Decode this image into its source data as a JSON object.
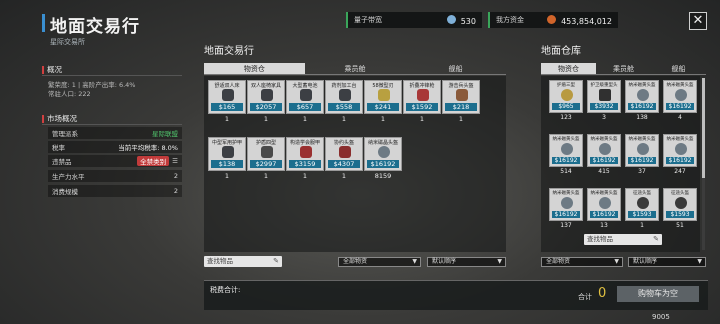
{
  "header": {
    "title": "地面交易行",
    "subtitle": "星际交易所",
    "bandwidth_label": "量子带宽",
    "bandwidth_value": "530",
    "funds_label": "我方资金",
    "funds_value": "453,854,012"
  },
  "overview": {
    "heading": "概况",
    "line1": "繁荣度: 1 | 高阶产出率: 6.4%",
    "line2": "常驻人口: 222"
  },
  "market": {
    "heading": "市场概况",
    "rows": [
      {
        "label": "管理派系",
        "value": "星际联盟"
      },
      {
        "label": "税率",
        "value": "当前平均税率: 8.0%"
      },
      {
        "label": "违禁品",
        "value": "全禁类别"
      },
      {
        "label": "生产力水平",
        "value": "2"
      },
      {
        "label": "消费规模",
        "value": "2"
      }
    ]
  },
  "trade": {
    "title": "地面交易行",
    "tabs": [
      "物资仓",
      "乘员舱",
      "舰船"
    ],
    "items": [
      {
        "name": "舒适双人床",
        "price": "$165",
        "qty": "1"
      },
      {
        "name": "双人座椅家具",
        "price": "$2057",
        "qty": "1"
      },
      {
        "name": "大型蓄电池",
        "price": "$657",
        "qty": "1"
      },
      {
        "name": "药剂加工台",
        "price": "$558",
        "qty": "1"
      },
      {
        "name": "58微型刃",
        "price": "$241",
        "qty": "1"
      },
      {
        "name": "折叠冲锋枪",
        "price": "$1592",
        "qty": "1"
      },
      {
        "name": "游击兵头盔",
        "price": "$218",
        "qty": "1"
      },
      {
        "name": "中型军用护甲",
        "price": "$138",
        "qty": "1"
      },
      {
        "name": "护盾四型",
        "price": "$2997",
        "qty": "1"
      },
      {
        "name": "构造学会服甲",
        "price": "$3159",
        "qty": "1"
      },
      {
        "name": "协约头盔",
        "price": "$4307",
        "qty": "1"
      },
      {
        "name": "纳米磁晶头盔",
        "price": "$16192",
        "qty": "8159"
      }
    ],
    "search_placeholder": "查找物品",
    "filter": "全部物资",
    "sort": "默认顺序"
  },
  "warehouse": {
    "title": "地面仓库",
    "tabs": [
      "物资仓",
      "乘员舱",
      "舰船"
    ],
    "items": [
      {
        "name": "护盾三型",
        "price": "$965",
        "qty": "123"
      },
      {
        "name": "护卫级重型头",
        "price": "$3932",
        "qty": "3"
      },
      {
        "name": "纳米磁黄头盔",
        "price": "$16192",
        "qty": "138"
      },
      {
        "name": "纳米磁黄头盔",
        "price": "$16192",
        "qty": "4"
      },
      {
        "name": "纳米磁黄头盔",
        "price": "$16192",
        "qty": "514"
      },
      {
        "name": "纳米磁黄头盔",
        "price": "$16192",
        "qty": "415"
      },
      {
        "name": "纳米磁黄头盔",
        "price": "$16192",
        "qty": "37"
      },
      {
        "name": "纳米磁黄头盔",
        "price": "$16192",
        "qty": "247"
      },
      {
        "name": "纳米磁黄头盔",
        "price": "$16192",
        "qty": "137"
      },
      {
        "name": "纳米磁黄头盔",
        "price": "$16192",
        "qty": "13"
      },
      {
        "name": "征途头盔",
        "price": "$1593",
        "qty": "1"
      },
      {
        "name": "征途头盔",
        "price": "$1593",
        "qty": "51"
      }
    ],
    "search_placeholder": "查找物品",
    "filter": "全部物资",
    "sort": "默认顺序"
  },
  "footer": {
    "tax_label": "税费合计:",
    "total_label": "合计",
    "total_value": "0",
    "empty_cart": "购物车为空",
    "bottom_number": "9005"
  },
  "colors": {
    "accent_blue": "#3a8fd0",
    "price_bg": "#1c6e8e",
    "positive_green": "#3aa55a",
    "alert_red": "#d04040"
  }
}
